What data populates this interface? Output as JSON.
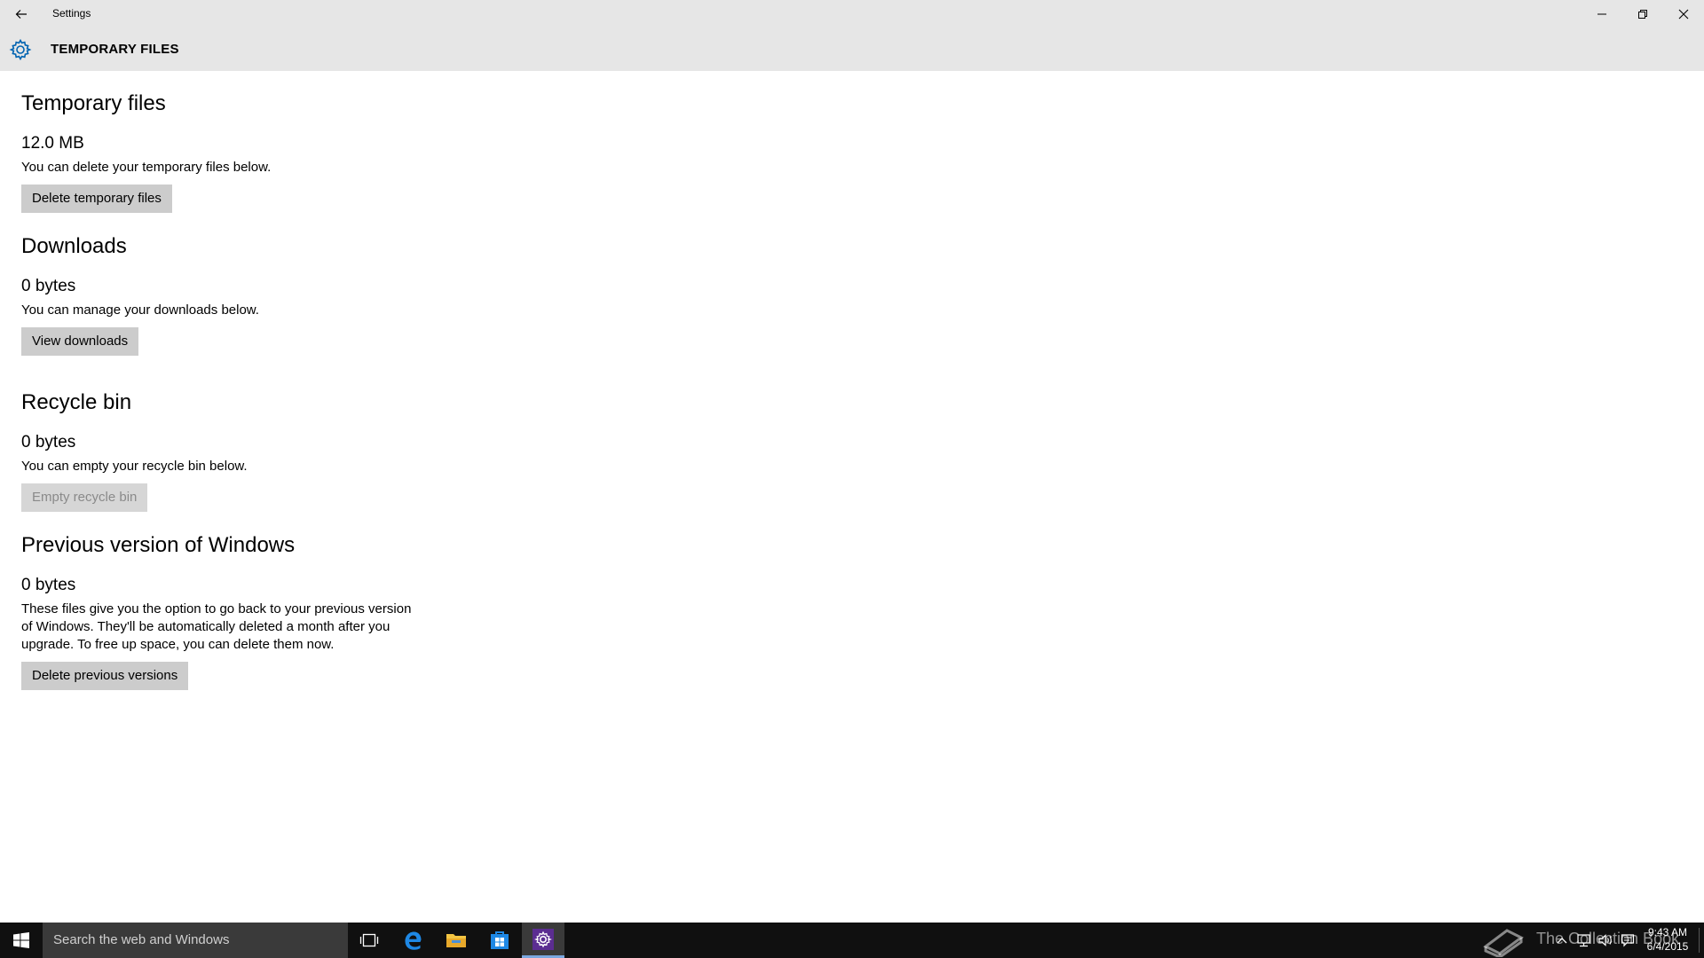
{
  "window": {
    "title": "Settings",
    "page_title": "TEMPORARY FILES"
  },
  "sections": [
    {
      "title": "Temporary files",
      "size": "12.0 MB",
      "description": "You can delete your temporary files below.",
      "button": "Delete temporary files",
      "button_enabled": true
    },
    {
      "title": "Downloads",
      "size": "0 bytes",
      "description": "You can manage your downloads below.",
      "button": "View downloads",
      "button_enabled": true
    },
    {
      "title": "Recycle bin",
      "size": "0 bytes",
      "description": "You can empty your recycle bin below.",
      "button": "Empty recycle bin",
      "button_enabled": false
    },
    {
      "title": "Previous version of Windows",
      "size": "0 bytes",
      "description": "These files give you the option to go back to your previous version of Windows. They'll be automatically deleted a month after you upgrade. To free up space, you can delete them now.",
      "button": "Delete previous versions",
      "button_enabled": true
    }
  ],
  "taskbar": {
    "search_placeholder": "Search the web and Windows",
    "pinned": [
      "task-view-icon",
      "edge-icon",
      "file-explorer-icon",
      "store-icon",
      "settings-icon"
    ],
    "active": "settings-icon",
    "watermark": "The Collection Book",
    "clock_time": "9:43 AM",
    "clock_date": "6/4/2015"
  },
  "colors": {
    "titlebar": "#e6e6e6",
    "accent": "#0063b1",
    "taskbar": "#101010",
    "button": "#cccccc"
  }
}
